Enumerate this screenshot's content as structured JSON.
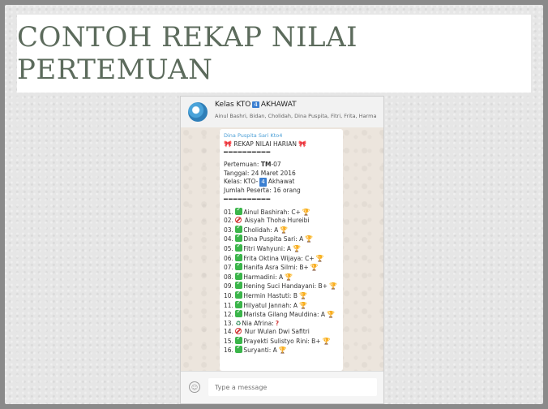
{
  "slide": {
    "title": "CONTOH REKAP NILAI PERTEMUAN"
  },
  "chat": {
    "name": "Kelas KTO",
    "name_number": "4",
    "name_suffix": "AKHAWAT",
    "members": "Ainul Bashri, Bidan, Cholidah, Dina Puspita, Fitri, Frita, Harma"
  },
  "message": {
    "sender": "Dina Puspita Sari Kto4",
    "header": "REKAP NILAI HARIAN",
    "dashes": "━━━━━━━━━━",
    "pertemuan_label": "Pertemuan:",
    "pertemuan_value": "TM",
    "pertemuan_suffix": "-07",
    "tanggal": "Tanggal: 24 Maret 2016",
    "kelas_prefix": "Kelas: KTO-",
    "kelas_number": "4",
    "kelas_suffix": "Akhawat",
    "jumlah": "Jumlah Peserta: 16 orang",
    "entries": [
      {
        "no": "01.",
        "icon": "check",
        "text": "Ainul Bashirah: C+",
        "trophy": true
      },
      {
        "no": "02.",
        "icon": "no",
        "text": "Aisyah Thoha Hureibi",
        "trophy": false
      },
      {
        "no": "03.",
        "icon": "check",
        "text": "Cholidah: A",
        "trophy": true
      },
      {
        "no": "04.",
        "icon": "check",
        "text": "Dina Puspita Sari: A",
        "trophy": true
      },
      {
        "no": "05.",
        "icon": "check",
        "text": "Fitri Wahyuni: A",
        "trophy": true
      },
      {
        "no": "06.",
        "icon": "check",
        "text": "Frita Oktina Wijaya: C+",
        "trophy": true
      },
      {
        "no": "07.",
        "icon": "check",
        "text": "Hanifa Asra Silmi: B+",
        "trophy": true
      },
      {
        "no": "08.",
        "icon": "check",
        "text": "Harmadini: A",
        "trophy": true
      },
      {
        "no": "09.",
        "icon": "check",
        "text": "Hening Suci Handayani: B+",
        "trophy": true
      },
      {
        "no": "10.",
        "icon": "check",
        "text": "Hermin Hastuti: B",
        "trophy": true
      },
      {
        "no": "11.",
        "icon": "check",
        "text": "Hilyatul Jannah: A",
        "trophy": true
      },
      {
        "no": "12.",
        "icon": "check",
        "text": "Marista Gilang Mauldina: A",
        "trophy": true
      },
      {
        "no": "13.",
        "icon": "recycle",
        "text": "Nia Afrina:",
        "trophy": false,
        "question": true
      },
      {
        "no": "14.",
        "icon": "no",
        "text": "Nur Wulan Dwi Safitri",
        "trophy": false
      },
      {
        "no": "15.",
        "icon": "check",
        "text": "Prayekti Sulistyo Rini: B+",
        "trophy": true
      },
      {
        "no": "16.",
        "icon": "check",
        "text": "Suryanti: A",
        "trophy": true
      }
    ]
  },
  "compose": {
    "placeholder": "Type a message"
  },
  "icons": {
    "check": "check-mark-button-icon",
    "no": "prohibited-icon",
    "recycle": "recycle-icon",
    "trophy": "trophy-icon",
    "question": "question-mark-icon",
    "ribbon": "ribbon-icon",
    "emoji": "emoji-icon"
  },
  "colors": {
    "title": "#5c6b5c",
    "check": "#3bb54a",
    "prohibited": "#d23b3b",
    "sender": "#4a9ed6"
  }
}
